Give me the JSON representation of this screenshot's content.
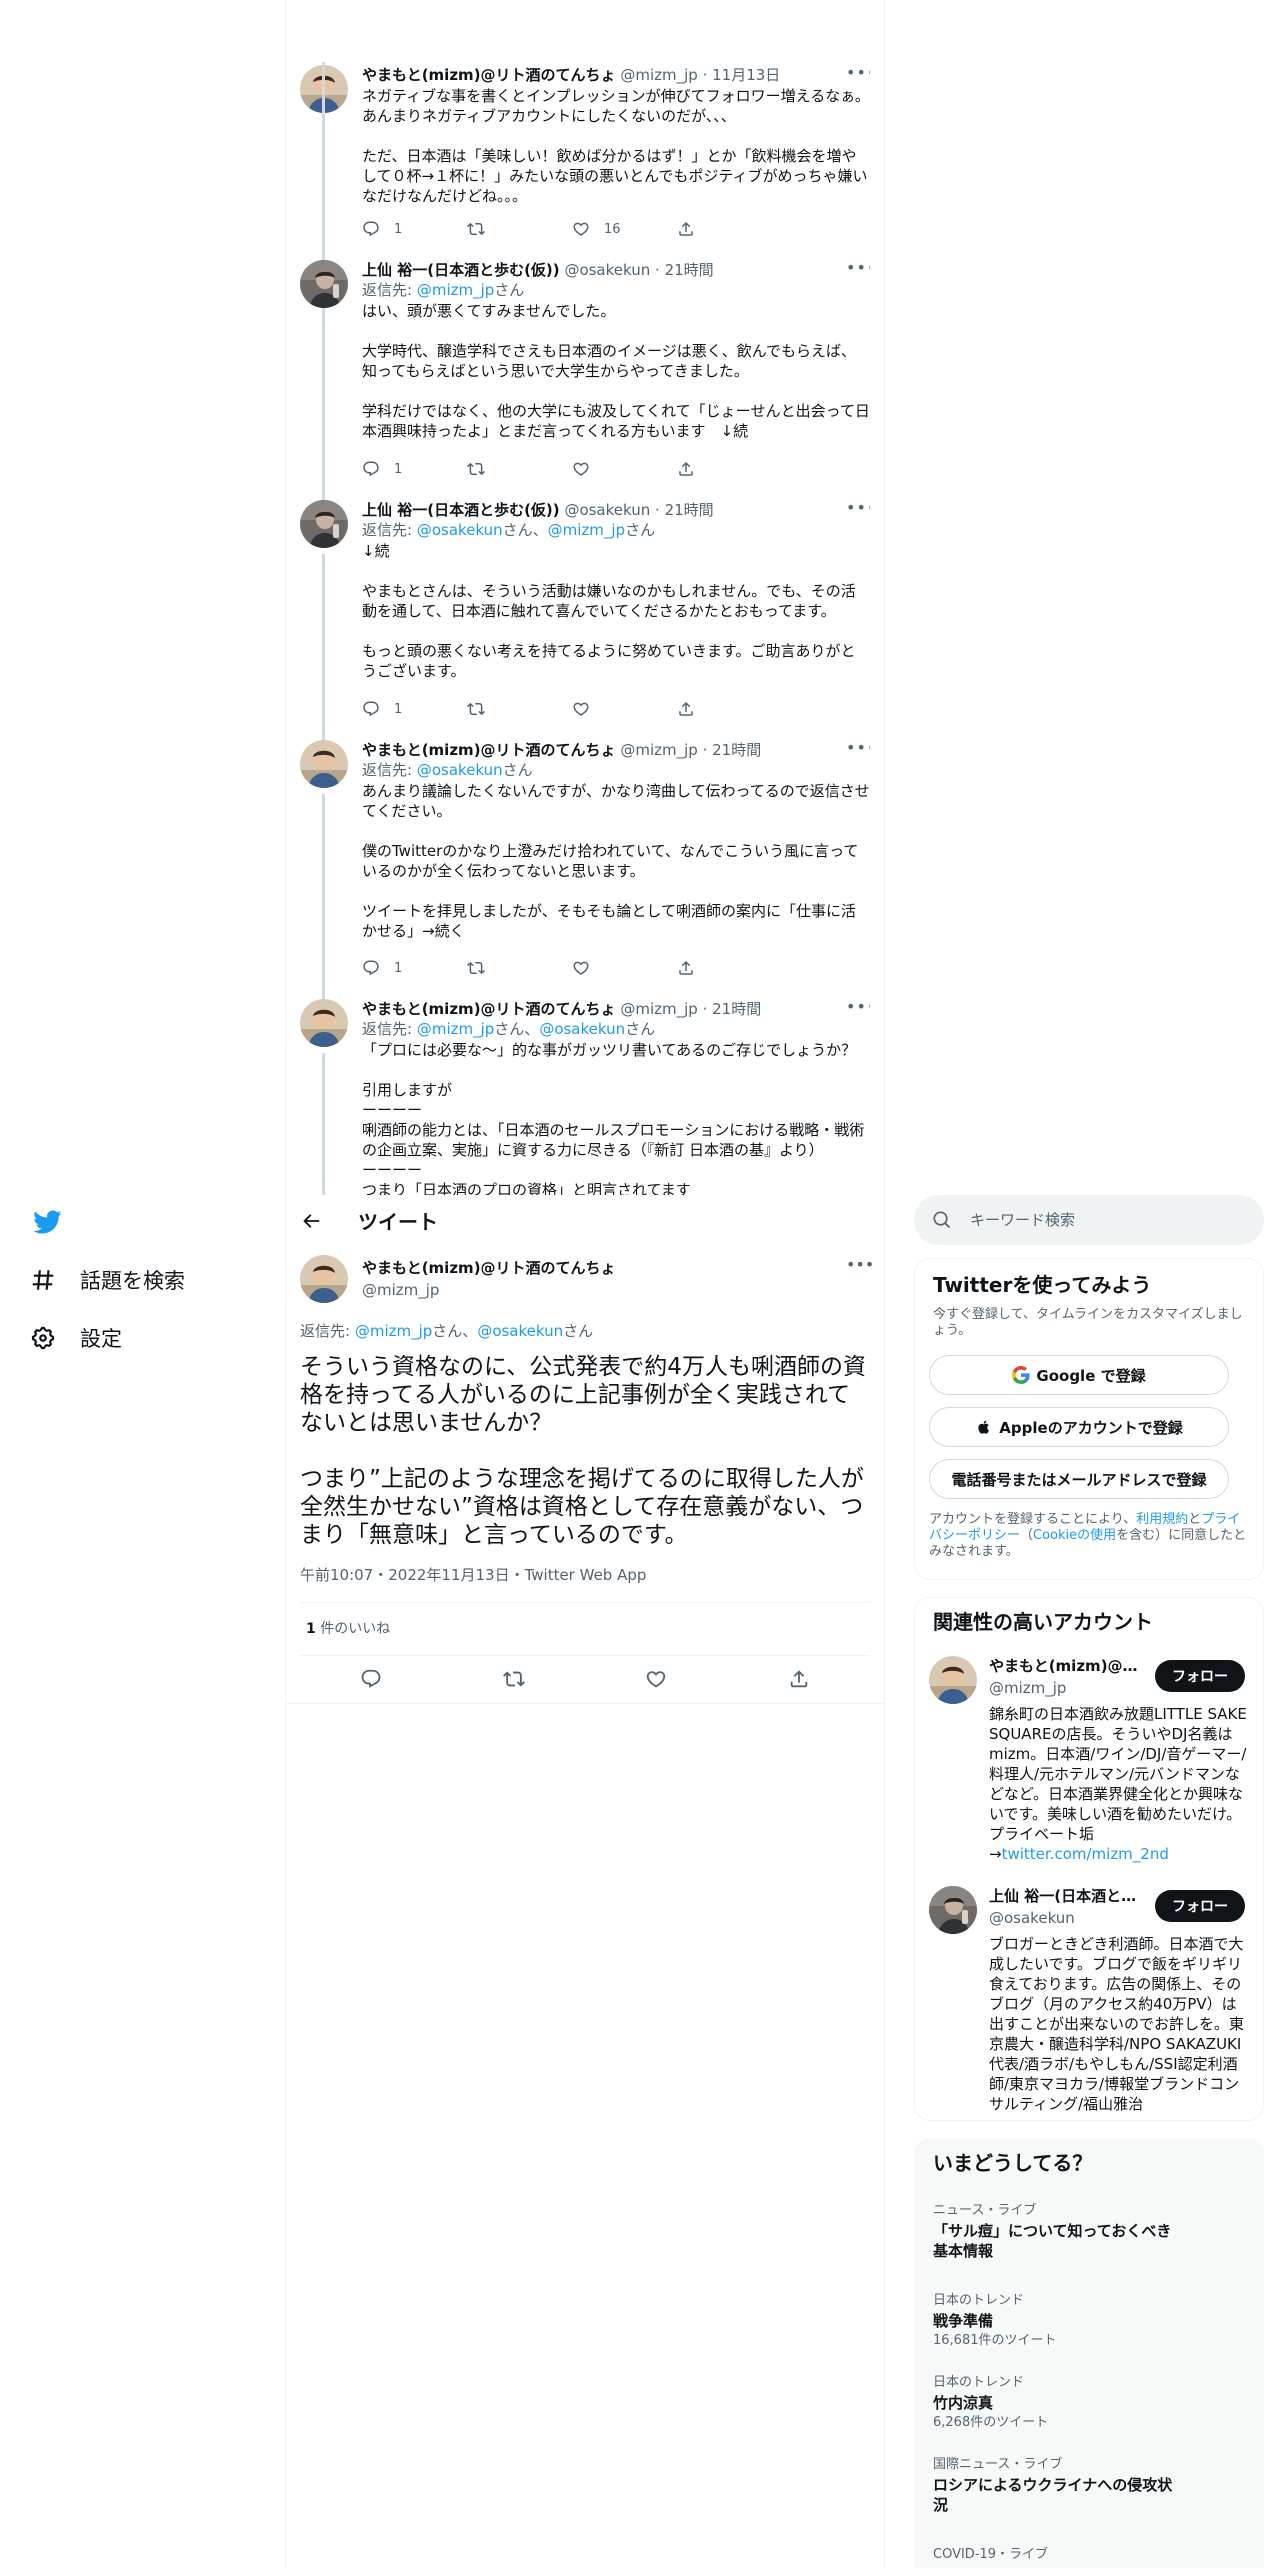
{
  "nav": {
    "explore_label": "話題を検索",
    "settings_label": "設定"
  },
  "replies": [
    {
      "name": "やまもと(mizm)@リト酒のてんちょ",
      "handle": "@mizm_jp",
      "time": "11月13日",
      "reply_prefix": "",
      "reply_to": "",
      "reply_suffix": "",
      "text": "ネガティブな事を書くとインプレッションが伸びてフォロワー増えるなぁ。あんまりネガティブアカウントにしたくないのだが、、、\n\nただ、日本酒は「美味しい！飲めば分かるはず！」とか「飲料機会を増やして０杯→１杯に！」みたいな頭の悪いとんでもポジティブがめっちゃ嫌いなだけなんだけどね。。。",
      "reply_count": "1",
      "retweet_count": "",
      "like_count": "16"
    },
    {
      "name": "上仙 裕一(日本酒と歩む(仮))",
      "handle": "@osakekun",
      "time": "21時間",
      "reply_prefix": "返信先: ",
      "reply_to": "@mizm_jp",
      "reply_suffix": "さん",
      "text": "はい、頭が悪くてすみませんでした。\n\n大学時代、醸造学科でさえも日本酒のイメージは悪く、飲んでもらえば、知ってもらえばという思いで大学生からやってきました。\n\n学科だけではなく、他の大学にも波及してくれて「じょーせんと出会って日本酒興味持ったよ」とまだ言ってくれる方もいます　↓続",
      "reply_count": "1",
      "retweet_count": "",
      "like_count": ""
    },
    {
      "name": "上仙 裕一(日本酒と歩む(仮))",
      "handle": "@osakekun",
      "time": "21時間",
      "reply_prefix": "返信先: ",
      "reply_to": "@osakekun",
      "reply_mid": "さん、",
      "reply_to2": "@mizm_jp",
      "reply_suffix": "さん",
      "text": "↓続\n\nやまもとさんは、そういう活動は嫌いなのかもしれません。でも、その活動を通して、日本酒に触れて喜んでいてくださるかたとおもってます。\n\nもっと頭の悪くない考えを持てるように努めていきます。ご助言ありがとうございます。",
      "reply_count": "1",
      "retweet_count": "",
      "like_count": ""
    },
    {
      "name": "やまもと(mizm)@リト酒のてんちょ",
      "handle": "@mizm_jp",
      "time": "21時間",
      "reply_prefix": "返信先: ",
      "reply_to": "@osakekun",
      "reply_suffix": "さん",
      "text": "あんまり議論したくないんですが、かなり湾曲して伝わってるので返信させてください。\n\n僕のTwitterのかなり上澄みだけ拾われていて、なんでこういう風に言っているのかが全く伝わってないと思います。\n\nツイートを拝見しましたが、そもそも論として唎酒師の案内に「仕事に活かせる」→続く",
      "reply_count": "1",
      "retweet_count": "",
      "like_count": ""
    },
    {
      "name": "やまもと(mizm)@リト酒のてんちょ",
      "handle": "@mizm_jp",
      "time": "21時間",
      "reply_prefix": "返信先: ",
      "reply_to": "@mizm_jp",
      "reply_mid": "さん、",
      "reply_to2": "@osakekun",
      "reply_suffix": "さん",
      "text": "「プロには必要な〜」的な事がガッツリ書いてあるのご存じでしょうか？\n\n引用しますが\nーーーー\n唎酒師の能力とは、「日本酒のセールスプロモーションにおける戦略・戦術の企画立案、実施」に資する力に尽きる（『新訂 日本酒の基』より）\nーーーー\nつまり「日本酒のプロの資格」と明言されてます",
      "reply_count": "",
      "retweet_count": "",
      "like_count": ""
    }
  ],
  "header": {
    "title": "ツイート"
  },
  "main_tweet": {
    "name": "やまもと(mizm)@リト酒のてんちょ",
    "handle": "@mizm_jp",
    "reply_prefix": "返信先: ",
    "reply_to": "@mizm_jp",
    "reply_mid": "さん、",
    "reply_to2": "@osakekun",
    "reply_suffix": "さん",
    "text": "そういう資格なのに、公式発表で約4万人も唎酒師の資格を持ってる人がいるのに上記事例が全く実践されてないとは思いませんか？\n\nつまり”上記のような理念を掲げてるのに取得した人が全然生かせない”資格は資格として存在意義がない、つまり「無意味」と言っているのです。",
    "meta": "午前10:07・2022年11月13日・Twitter Web App",
    "likes_count": "1",
    "likes_label": " 件のいいね"
  },
  "search": {
    "placeholder": "キーワード検索"
  },
  "signup": {
    "title": "Twitterを使ってみよう",
    "subtitle": "今すぐ登録して、タイムラインをカスタマイズしましょう。",
    "google_label": "Google で登録",
    "apple_label": "Appleのアカウントで登録",
    "email_label": "電話番号またはメールアドレスで登録",
    "terms_prefix": "アカウントを登録することにより、",
    "terms_link1": "利用規約",
    "terms_and": "と",
    "terms_link2": "プライバシーポリシー",
    "terms_open": "（",
    "terms_link3": "Cookieの使用",
    "terms_suffix": "を含む）に同意したとみなされます。"
  },
  "relevant": {
    "title": "関連性の高いアカウント",
    "follow_label": "フォロー",
    "people": [
      {
        "name": "やまもと(mizm)@リト酒のてんちょ",
        "handle": "@mizm_jp",
        "bio": "錦糸町の日本酒飲み放題LITTLE SAKE SQUAREの店長。そういやDJ名義はmizm。日本酒/ワイン/DJ/音ゲーマー/料理人/元ホテルマン/元バンドマンなどなど。日本酒業界健全化とか興味ないです。美味しい酒を勧めたいだけ。プライベート垢\n→",
        "link": "twitter.com/mizm_2nd"
      },
      {
        "name": "上仙 裕一(日本酒と歩む(仮))",
        "handle": "@osakekun",
        "bio": "ブロガーときどき利酒師。日本酒で大成したいです。ブログで飯をギリギリ食えております。広告の関係上、そのブログ（月のアクセス約40万PV）は出すことが出来ないのでお許しを。東京農大・醸造科学科/NPO SAKAZUKI代表/酒ラボ/もやしもん/SSI認定利酒師/東京マヨカラ/博報堂ブランドコンサルティング/福山雅治",
        "link": ""
      }
    ]
  },
  "trends": {
    "title": "いまどうしてる？",
    "items": [
      {
        "category": "ニュース・ライブ",
        "title": "「サル痘」について知っておくべき基本情報",
        "count": ""
      },
      {
        "category": "日本のトレンド",
        "title": "戦争準備",
        "count": "16,681件のツイート"
      },
      {
        "category": "日本のトレンド",
        "title": "竹内涼真",
        "count": "6,268件のツイート"
      },
      {
        "category": "国際ニュース・ライブ",
        "title": "ロシアによるウクライナへの侵攻状況",
        "count": ""
      },
      {
        "category": "COVID-19・ライブ",
        "title": "",
        "count": ""
      }
    ]
  },
  "colors": {
    "accent": "#1d9bf0",
    "text": "#0f1419",
    "secondary": "#536471"
  }
}
